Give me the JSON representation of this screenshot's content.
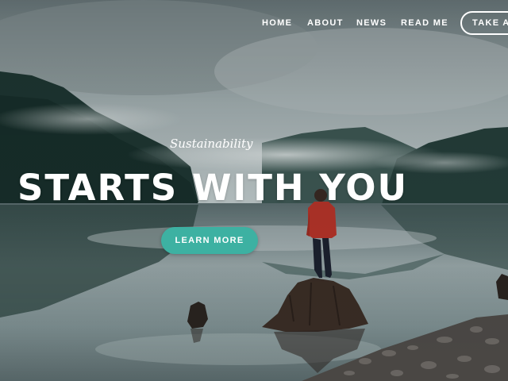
{
  "nav": {
    "items": [
      {
        "label": "HOME"
      },
      {
        "label": "ABOUT"
      },
      {
        "label": "NEWS"
      },
      {
        "label": "READ ME"
      }
    ],
    "cta_label": "TAKE AC"
  },
  "hero": {
    "eyebrow": "Sustainability",
    "headline": "STARTS WITH YOU",
    "button_label": "LEARN MORE",
    "image_subject": "person-standing-on-tree-stump-lake-reflection"
  },
  "colors": {
    "accent": "#3db1a2",
    "text": "#ffffff"
  }
}
